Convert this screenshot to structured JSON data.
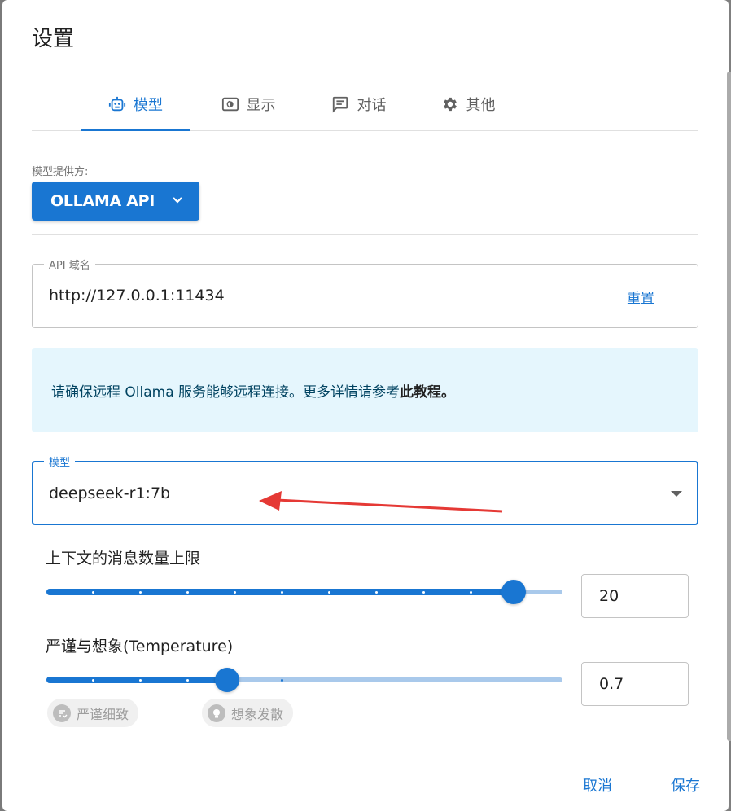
{
  "dialog": {
    "title": "设置"
  },
  "tabs": [
    {
      "label": "模型",
      "icon": "robot-icon",
      "active": true
    },
    {
      "label": "显示",
      "icon": "display-icon",
      "active": false
    },
    {
      "label": "对话",
      "icon": "chat-icon",
      "active": false
    },
    {
      "label": "其他",
      "icon": "gear-icon",
      "active": false
    }
  ],
  "provider": {
    "label": "模型提供方:",
    "value": "OLLAMA API"
  },
  "api_domain": {
    "label": "API 域名",
    "value": "http://127.0.0.1:11434",
    "reset_label": "重置"
  },
  "info": {
    "text": "请确保远程 Ollama 服务能够远程连接。更多详情请参考",
    "link_text": "此教程",
    "suffix": "。"
  },
  "model": {
    "label": "模型",
    "value": "deepseek-r1:7b"
  },
  "context_limit": {
    "label": "上下文的消息数量上限",
    "value": "20",
    "fraction": 0.906
  },
  "temperature": {
    "label": "严谨与想象(Temperature)",
    "value": "0.7",
    "fraction": 0.35,
    "chips": [
      {
        "label": "严谨细致",
        "icon": "precise-icon"
      },
      {
        "label": "想象发散",
        "icon": "lightbulb-icon"
      }
    ]
  },
  "actions": {
    "cancel": "取消",
    "save": "保存"
  },
  "colors": {
    "primary": "#1976d2",
    "info_bg": "#e5f6fd",
    "info_text": "#014361",
    "annotation_arrow": "#e53935"
  }
}
